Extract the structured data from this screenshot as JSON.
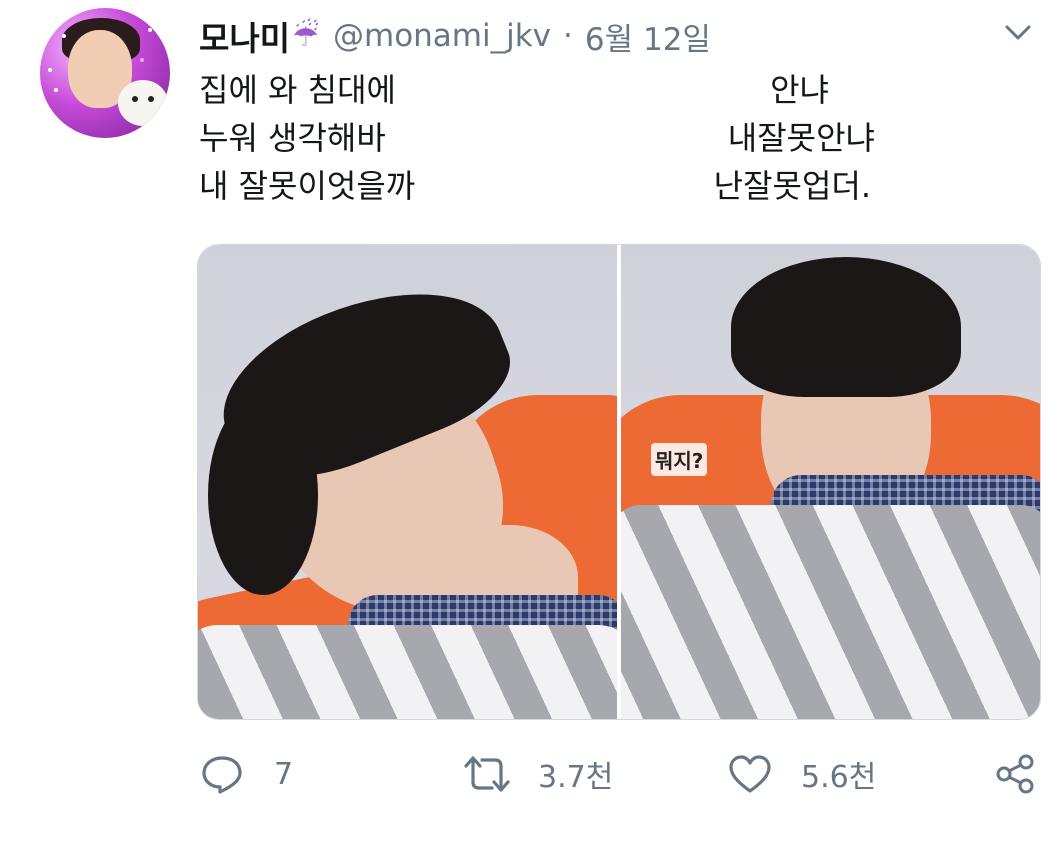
{
  "user": {
    "display_name": "모나미",
    "name_emoji": "☔",
    "handle": "@monami_jkv",
    "separator": "·",
    "date": "6월 12일",
    "avatar_icon": "profile-avatar"
  },
  "tweet": {
    "lines": [
      {
        "left": "집에 와 침대에",
        "right": "안냐"
      },
      {
        "left": "누워 생각해바",
        "right": "내잘못안냐"
      },
      {
        "left": "내 잘못이엇을까",
        "right": "난잘못업더."
      }
    ]
  },
  "media": {
    "right_panel_caption": "뭐지?"
  },
  "actions": {
    "reply_count": "7",
    "retweet_count": "3.7천",
    "like_count": "5.6천"
  },
  "colors": {
    "text": "#14171a",
    "muted": "#657786",
    "border": "#cfd9de"
  }
}
